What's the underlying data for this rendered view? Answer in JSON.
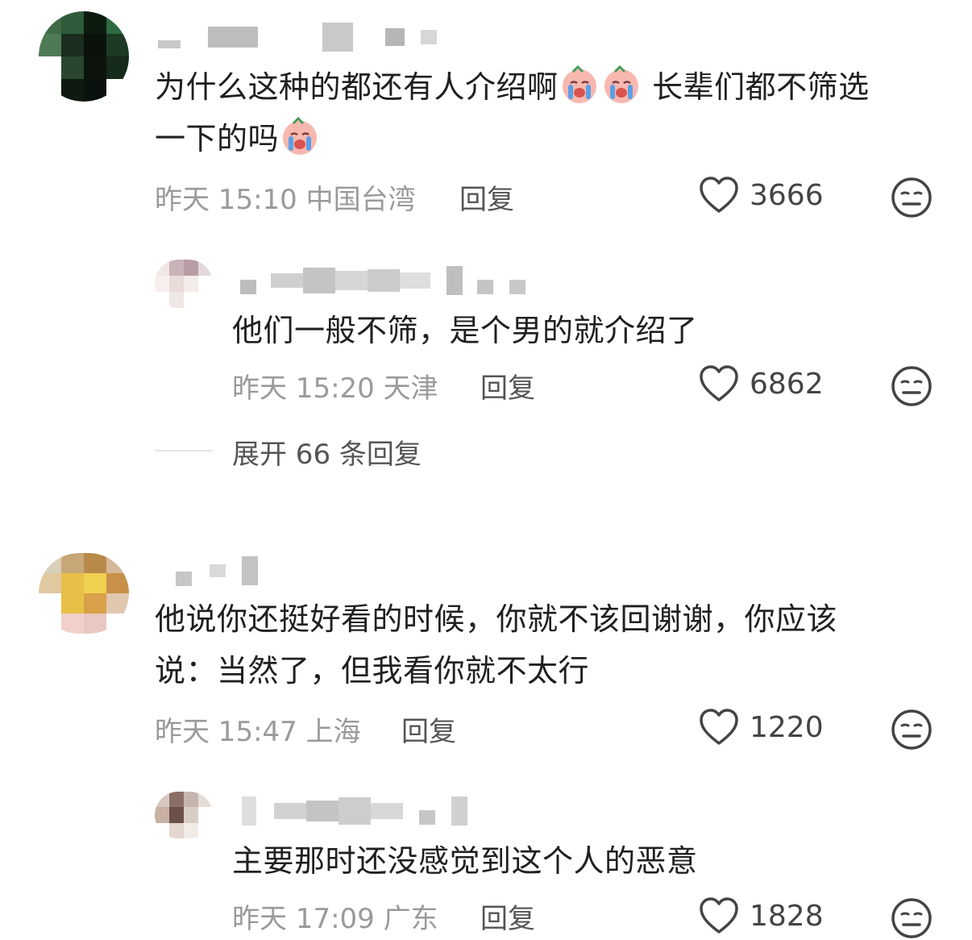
{
  "comments": [
    {
      "text_a": "为什么这种的都还有人介绍啊",
      "text_b": "长辈们都不筛选",
      "text_c": "一下的吗",
      "time": "昨天 15:10",
      "location": "中国台湾",
      "reply_label": "回复",
      "likes": "3666"
    },
    {
      "text": "他们一般不筛，是个男的就介绍了",
      "time": "昨天 15:20",
      "location": "天津",
      "reply_label": "回复",
      "likes": "6862"
    },
    {
      "text_line1": "他说你还挺好看的时候，你就不该回谢谢，你应该",
      "text_line2": "说：当然了，但我看你就不太行",
      "time": "昨天 15:47",
      "location": "上海",
      "reply_label": "回复",
      "likes": "1220"
    },
    {
      "text": "主要那时还没感觉到这个人的恶意",
      "time": "昨天 17:09",
      "location": "广东",
      "reply_label": "回复",
      "likes": "1828"
    }
  ],
  "expand": {
    "label": "展开 66 条回复"
  },
  "icons": {
    "emoji": "crying-face-emoji",
    "like": "heart-outline-icon",
    "dislike": "meh-face-icon"
  },
  "colors": {
    "meta": "#9a9a9a",
    "text": "#202020",
    "icon": "#444444"
  }
}
